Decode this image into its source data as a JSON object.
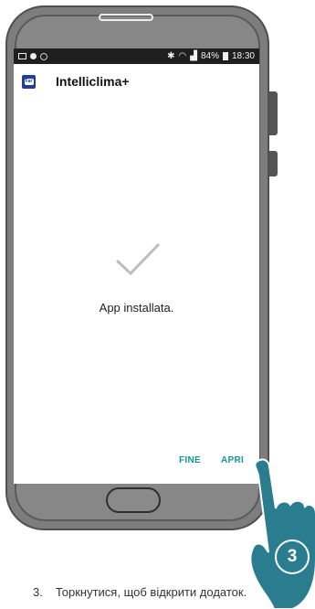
{
  "status_bar": {
    "battery": "84%",
    "time": "18:30"
  },
  "app": {
    "logo_text": "Far",
    "title": "Intelliclima+"
  },
  "install": {
    "message": "App installata."
  },
  "actions": {
    "fine_label": "FINE",
    "apri_label": "APRI"
  },
  "instruction": {
    "step_badge": "3",
    "number": "3.",
    "text": "Торкнутися, щоб відкрити додаток."
  },
  "colors": {
    "accent": "#11998e",
    "phone_body": "#7d7d7d",
    "hand": "#2a7d8f"
  }
}
